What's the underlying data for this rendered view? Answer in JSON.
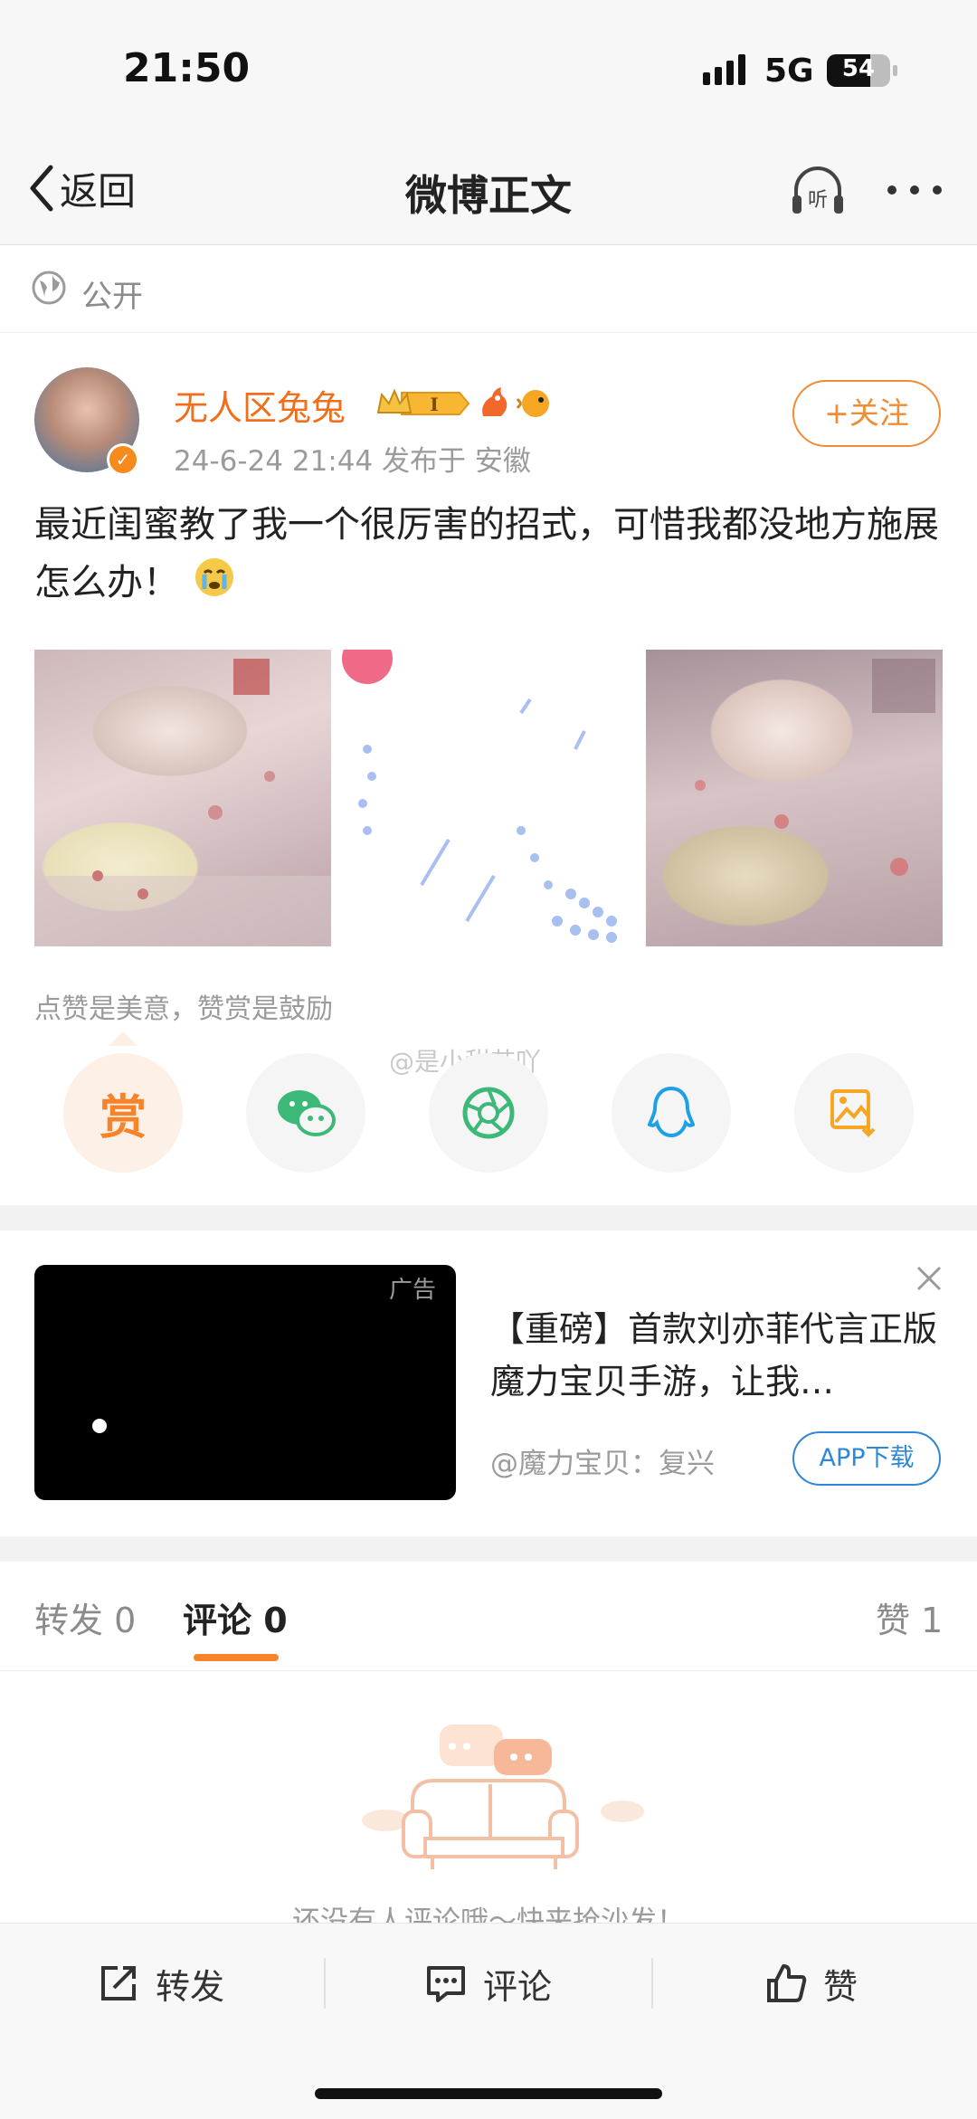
{
  "status_bar": {
    "time": "21:50",
    "network": "5G",
    "battery": "54"
  },
  "nav": {
    "back_label": "返回",
    "title": "微博正文"
  },
  "visibility": "公开",
  "post": {
    "author": "无人区兔兔",
    "meta": "24-6-24 21:44  发布于 安徽",
    "follow_label": "+关注",
    "text": "最近闺蜜教了我一个很厉害的招式，可惜我都没地方施展怎么办！",
    "praise_text": "点赞是美意，赞赏是鼓励",
    "watermark": "@是小甜芯吖",
    "reward_label": "赏"
  },
  "ad": {
    "tag": "广告",
    "title": "【重磅】首款刘亦菲代言正版魔力宝贝手游，让我…",
    "source": "@魔力宝贝：复兴",
    "button": "APP下载"
  },
  "tabs": {
    "repost": "转发 0",
    "comment": "评论 0",
    "like": "赞 1"
  },
  "empty": {
    "text": "还没有人评论哦～快来抢沙发！"
  },
  "bottom": {
    "repost": "转发",
    "comment": "评论",
    "like": "赞"
  },
  "colors": {
    "accent_orange": "#f7832a",
    "ad_blue": "#2f88d6",
    "username": "#f06f1c"
  }
}
